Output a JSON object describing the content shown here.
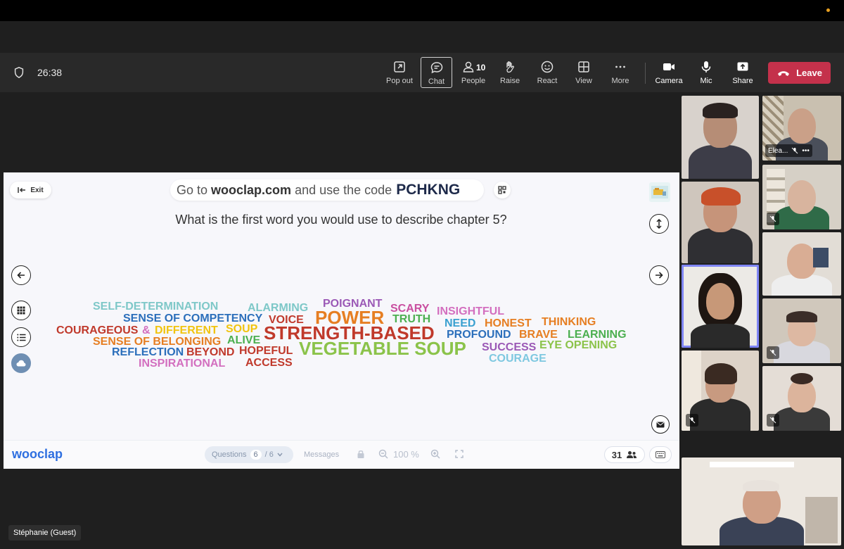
{
  "toolbar": {
    "timer": "26:38",
    "buttons": [
      {
        "id": "popout",
        "label": "Pop out"
      },
      {
        "id": "chat",
        "label": "Chat"
      },
      {
        "id": "people",
        "label": "People",
        "count": "10"
      },
      {
        "id": "raise",
        "label": "Raise"
      },
      {
        "id": "react",
        "label": "React"
      },
      {
        "id": "view",
        "label": "View"
      },
      {
        "id": "more",
        "label": "More"
      },
      {
        "id": "camera",
        "label": "Camera"
      },
      {
        "id": "mic",
        "label": "Mic"
      },
      {
        "id": "share",
        "label": "Share"
      }
    ],
    "leave_label": "Leave",
    "leave_color": "#c4314b"
  },
  "presentation": {
    "exit_label": "Exit",
    "code_text_1": "Go to",
    "code_site": "wooclap.com",
    "code_text_2": "and use the code",
    "code": "PCHKNG",
    "question": "What is the first word you would use to describe chapter 5?",
    "words": [
      {
        "text": "SELF-DETERMINATION",
        "color": "#7ec8c8"
      },
      {
        "text": "ALARMING",
        "color": "#7ec8c8"
      },
      {
        "text": "POIGNANT",
        "color": "#9b59b6"
      },
      {
        "text": "SCARY",
        "color": "#c94fa0"
      },
      {
        "text": "INSIGHTFUL",
        "color": "#d36fbf"
      },
      {
        "text": "SENSE OF COMPETENCY",
        "color": "#2c6fbb"
      },
      {
        "text": "POWER",
        "color": "#e67e22"
      },
      {
        "text": "VOICE",
        "color": "#c0392b"
      },
      {
        "text": "TRUTH",
        "color": "#4caf50"
      },
      {
        "text": "NEED",
        "color": "#3aa0d0"
      },
      {
        "text": "HONEST",
        "color": "#e67e22"
      },
      {
        "text": "THINKING",
        "color": "#e67e22"
      },
      {
        "text": "COURAGEOUS",
        "color": "#c0392b"
      },
      {
        "text": "&",
        "color": "#d36fbf"
      },
      {
        "text": "DIFFERENT",
        "color": "#f1c40f"
      },
      {
        "text": "SOUP",
        "color": "#f1c40f"
      },
      {
        "text": "STRENGTH-BASED",
        "color": "#c0392b"
      },
      {
        "text": "PROFOUND",
        "color": "#2c6fbb"
      },
      {
        "text": "BRAVE",
        "color": "#e67e22"
      },
      {
        "text": "LEARNING",
        "color": "#4caf50"
      },
      {
        "text": "SENSE OF BELONGING",
        "color": "#e67e22"
      },
      {
        "text": "ALIVE",
        "color": "#4caf50"
      },
      {
        "text": "REFLECTION",
        "color": "#2c6fbb"
      },
      {
        "text": "BEYOND",
        "color": "#c0392b"
      },
      {
        "text": "HOPEFUL",
        "color": "#c0392b"
      },
      {
        "text": "VEGETABLE SOUP",
        "color": "#8bc34a"
      },
      {
        "text": "SUCCESS",
        "color": "#9b59b6"
      },
      {
        "text": "EYE OPENING",
        "color": "#8bc34a"
      },
      {
        "text": "INSPIRATIONAL",
        "color": "#d36fbf"
      },
      {
        "text": "ACCESS",
        "color": "#c0392b"
      },
      {
        "text": "COURAGE",
        "color": "#7ec8e0"
      }
    ]
  },
  "footer": {
    "logo": "wooclap",
    "questions_label": "Questions",
    "question_current": "6",
    "question_total": "/ 6",
    "messages_label": "Messages",
    "zoom": "100 %",
    "participants": "31"
  },
  "participants": {
    "self_name": "Stéphanie (Guest)",
    "tile_2_label": "Elea..."
  }
}
